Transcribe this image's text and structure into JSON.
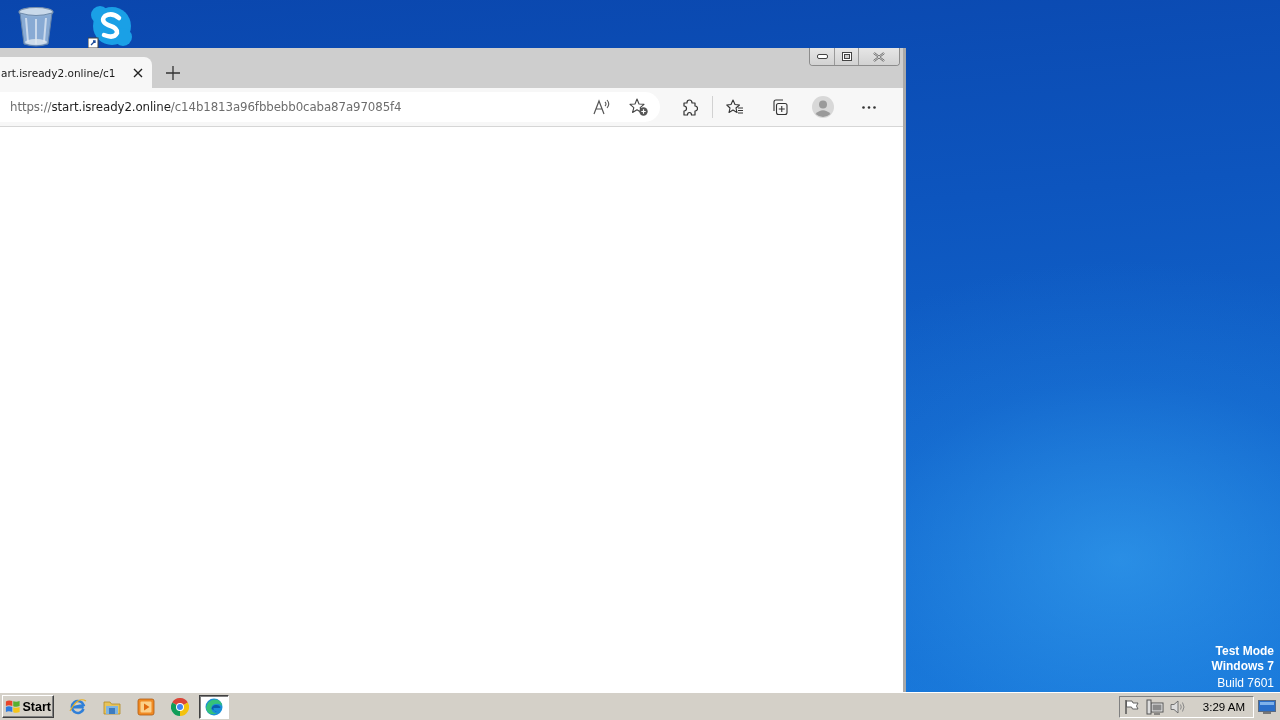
{
  "browser": {
    "tabs": [
      {
        "title": "art.isready2.online/c1",
        "selected": true
      }
    ],
    "address": {
      "scheme": "https://",
      "host": "start.isready2.online",
      "path": "/c14b1813a96fbbebb0caba87a97085f4"
    }
  },
  "desktop_notice": {
    "mode": "Test Mode",
    "os": "Windows 7",
    "build": "Build 7601"
  },
  "taskbar": {
    "start": "Start",
    "buttons": [
      {
        "kind": "ie",
        "active": false
      },
      {
        "kind": "explorer",
        "active": false
      },
      {
        "kind": "media-player",
        "active": false
      },
      {
        "kind": "chrome",
        "active": false
      },
      {
        "kind": "edge",
        "active": true
      }
    ],
    "clock": "3:29 AM"
  }
}
